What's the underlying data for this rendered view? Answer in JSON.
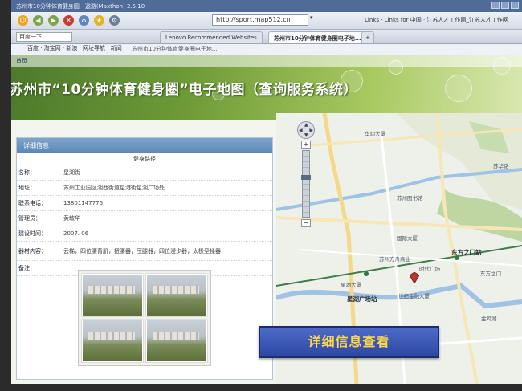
{
  "browser": {
    "title": "苏州市10分钟体育健身圈 - 遨游(Maxthon) 2.5.10",
    "address": "http://sport.map512.cn",
    "links_label": "Links",
    "links_for": "Links for 中国",
    "top_links": "江苏人才工作网_江苏人才工作网",
    "search_placeholder": "百度一下",
    "tabs": [
      {
        "label": "Lenovo Recommended Websites"
      },
      {
        "label": "苏州市10分钟体育健身圈电子地..."
      }
    ],
    "bookmarks": "百度 · 淘宝网 · 新浪 · 网址导航 · 新闻",
    "sub_tabs": [
      {
        "label": "苏州市10分钟体育健身圈电子地..."
      }
    ]
  },
  "banner": {
    "title": "苏州市“10分钟体育健身圈”电子地图（查询服务系统）",
    "nav": "首页"
  },
  "panel": {
    "header": "详细信息",
    "caption": "健身路径",
    "rows": [
      {
        "label": "名称：",
        "value": "星湖街"
      },
      {
        "label": "地址：",
        "value": "苏州工业园区湖西街道星港街星湖广场处"
      },
      {
        "label": "联系电话：",
        "value": "13801147776"
      },
      {
        "label": "管理员：",
        "value": "黄敏华"
      },
      {
        "label": "建设时间：",
        "value": "2007. 06"
      },
      {
        "label": "器材内容：",
        "value": "云梯，四位腰背肌，扭腰器，压腿器，四位漫步器，太极圣揉器"
      },
      {
        "label": "备注：",
        "value": ""
      }
    ]
  },
  "map": {
    "labels": [
      {
        "text": "华润大厦",
        "cls": ""
      },
      {
        "text": "苏州图书馆",
        "cls": ""
      },
      {
        "text": "东方之门站",
        "cls": "bold"
      },
      {
        "text": "东方之门",
        "cls": ""
      },
      {
        "text": "星湖广场站",
        "cls": "bold"
      },
      {
        "text": "世纪金融大厦",
        "cls": ""
      },
      {
        "text": "国际大厦",
        "cls": ""
      },
      {
        "text": "时代广场",
        "cls": ""
      },
      {
        "text": "苏州方舟商业",
        "cls": ""
      },
      {
        "text": "星湖大厦",
        "cls": ""
      },
      {
        "text": "金鸡湖",
        "cls": ""
      },
      {
        "text": "苏华路",
        "cls": ""
      }
    ],
    "zoom_plus": "+",
    "zoom_minus": "−"
  },
  "detail_button": "详细信息查看",
  "colors": {
    "banner_green": "#6e9b37",
    "panel_header_blue": "#5d88b6",
    "button_blue": "#2d48a3",
    "button_text_yellow": "#ffd84a",
    "marker_red": "#b8362b"
  }
}
